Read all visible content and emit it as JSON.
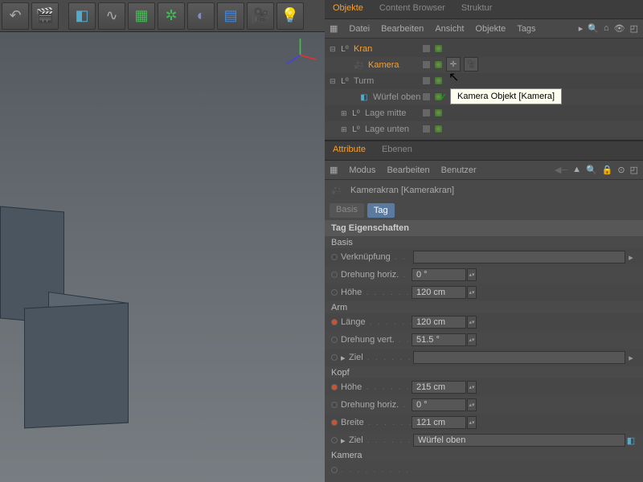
{
  "topTabs": {
    "objekte": "Objekte",
    "content": "Content Browser",
    "struktur": "Struktur"
  },
  "objMenu": {
    "datei": "Datei",
    "bearbeiten": "Bearbeiten",
    "ansicht": "Ansicht",
    "objekte": "Objekte",
    "tags": "Tags"
  },
  "tree": {
    "kran": "Kran",
    "kamera": "Kamera",
    "turm": "Turm",
    "wuerfel": "Würfel oben",
    "lageMitte": "Lage mitte",
    "lageUnten": "Lage unten"
  },
  "tooltip": "Kamera Objekt [Kamera]",
  "attrTabs": {
    "attribute": "Attribute",
    "ebenen": "Ebenen"
  },
  "attrMenu": {
    "modus": "Modus",
    "bearbeiten": "Bearbeiten",
    "benutzer": "Benutzer"
  },
  "objName": "Kamerakran [Kamerakran]",
  "subTabs": {
    "basis": "Basis",
    "tag": "Tag"
  },
  "sectTitle": "Tag Eigenschaften",
  "groups": {
    "basis": "Basis",
    "arm": "Arm",
    "kopf": "Kopf",
    "kamera": "Kamera"
  },
  "props": {
    "verkn": "Verknüpfung",
    "drehH": "Drehung horiz.",
    "hoehe": "Höhe",
    "laenge": "Länge",
    "drehV": "Drehung vert.",
    "ziel": "Ziel",
    "breite": "Breite"
  },
  "vals": {
    "drehH1": "0 °",
    "hoehe1": "120 cm",
    "laenge": "120 cm",
    "drehV": "51.5 °",
    "hoehe2": "215 cm",
    "drehH2": "0 °",
    "breite": "121 cm",
    "zielKopf": "Würfel oben"
  }
}
